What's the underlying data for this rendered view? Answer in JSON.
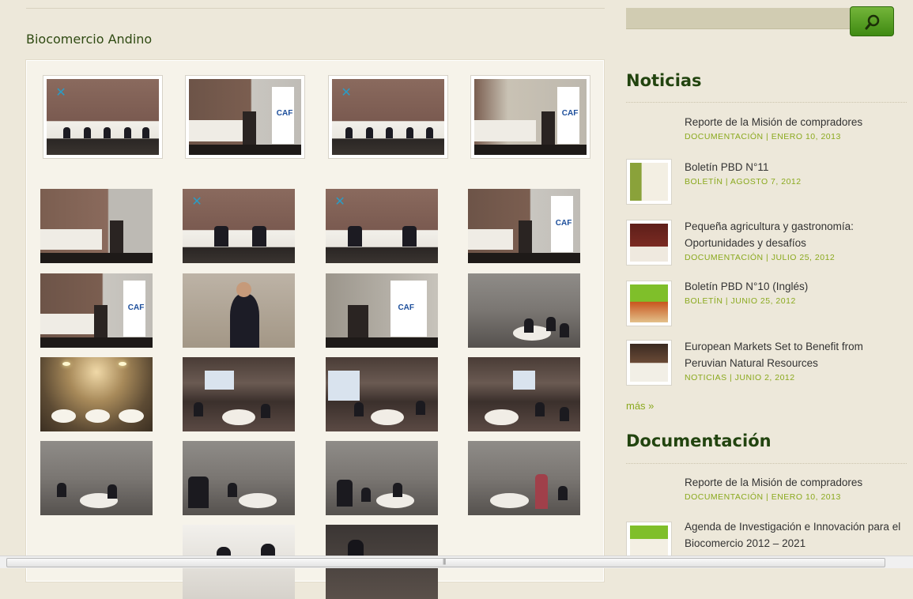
{
  "gallery": {
    "title": "Biocomercio Andino"
  },
  "search": {
    "button_icon": "search-icon",
    "accent": "#4a9a1c"
  },
  "noticias": {
    "title": "Noticias",
    "items": [
      {
        "title": "Reporte de la Misión de compradores",
        "meta": "DOCUMENTACIÓN | ENERO 10, 2013",
        "has_thumb": false
      },
      {
        "title": "Boletín PBD N°11",
        "meta": "BOLETÍN | AGOSTO 7, 2012",
        "has_thumb": true
      },
      {
        "title": "Pequeña agricultura y gastronomía: Oportunidades y desafíos",
        "meta": "DOCUMENTACIÓN | JULIO 25, 2012",
        "has_thumb": true
      },
      {
        "title": "Boletín PBD N°10 (Inglés)",
        "meta": "BOLETÍN | JUNIO 25, 2012",
        "has_thumb": true
      },
      {
        "title": "European Markets Set to Benefit from Peruvian Natural Resources",
        "meta": "NOTICIAS | JUNIO 2, 2012",
        "has_thumb": true
      }
    ],
    "more_label": "más »"
  },
  "documentacion": {
    "title": "Documentación",
    "items": [
      {
        "title": "Reporte de la Misión de compradores",
        "meta": "DOCUMENTACIÓN | ENERO 10, 2013"
      },
      {
        "title": "Agenda de Investigación e Innovación para el Biocomercio 2012 – 2021",
        "meta": ""
      }
    ]
  },
  "colors": {
    "background": "#ede8da",
    "heading": "#22440f",
    "meta": "#8aa91e"
  }
}
